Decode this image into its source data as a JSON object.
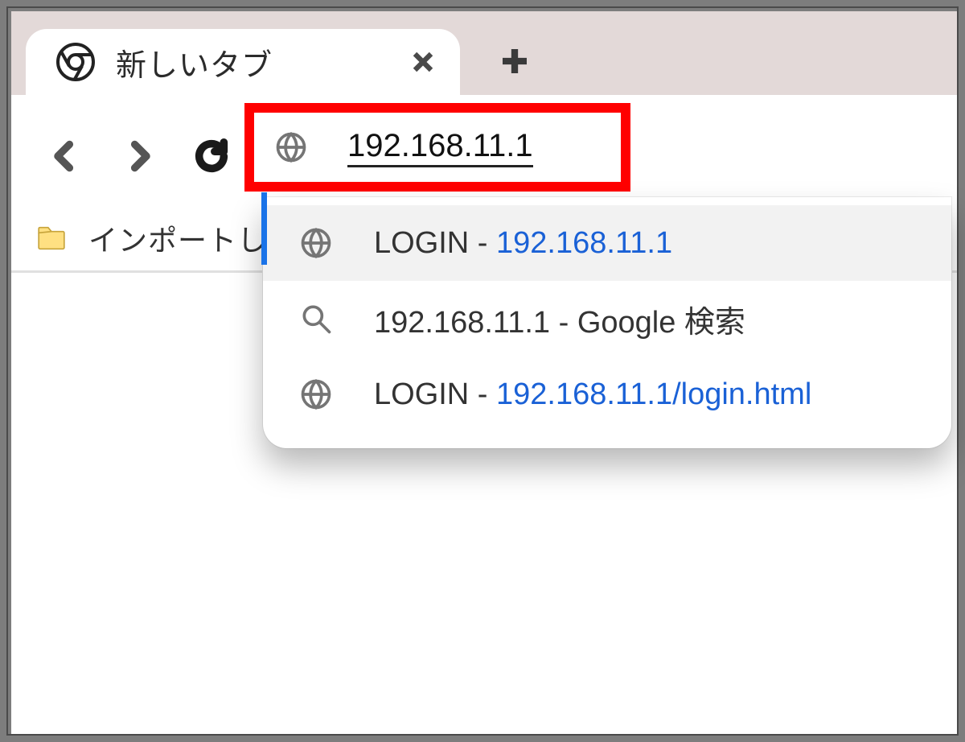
{
  "tab": {
    "title": "新しいタブ"
  },
  "addr": {
    "value": "192.168.11.1"
  },
  "bookmarks": {
    "folder": "インポートした"
  },
  "suggestions": [
    {
      "icon": "globe",
      "prefix": "LOGIN - ",
      "url": "192.168.11.1",
      "selected": true
    },
    {
      "icon": "search",
      "prefix": "192.168.11.1",
      "suffix": " - Google 検索",
      "selected": false
    },
    {
      "icon": "globe",
      "prefix": "LOGIN - ",
      "url": "192.168.11.1/login.html",
      "selected": false
    }
  ]
}
